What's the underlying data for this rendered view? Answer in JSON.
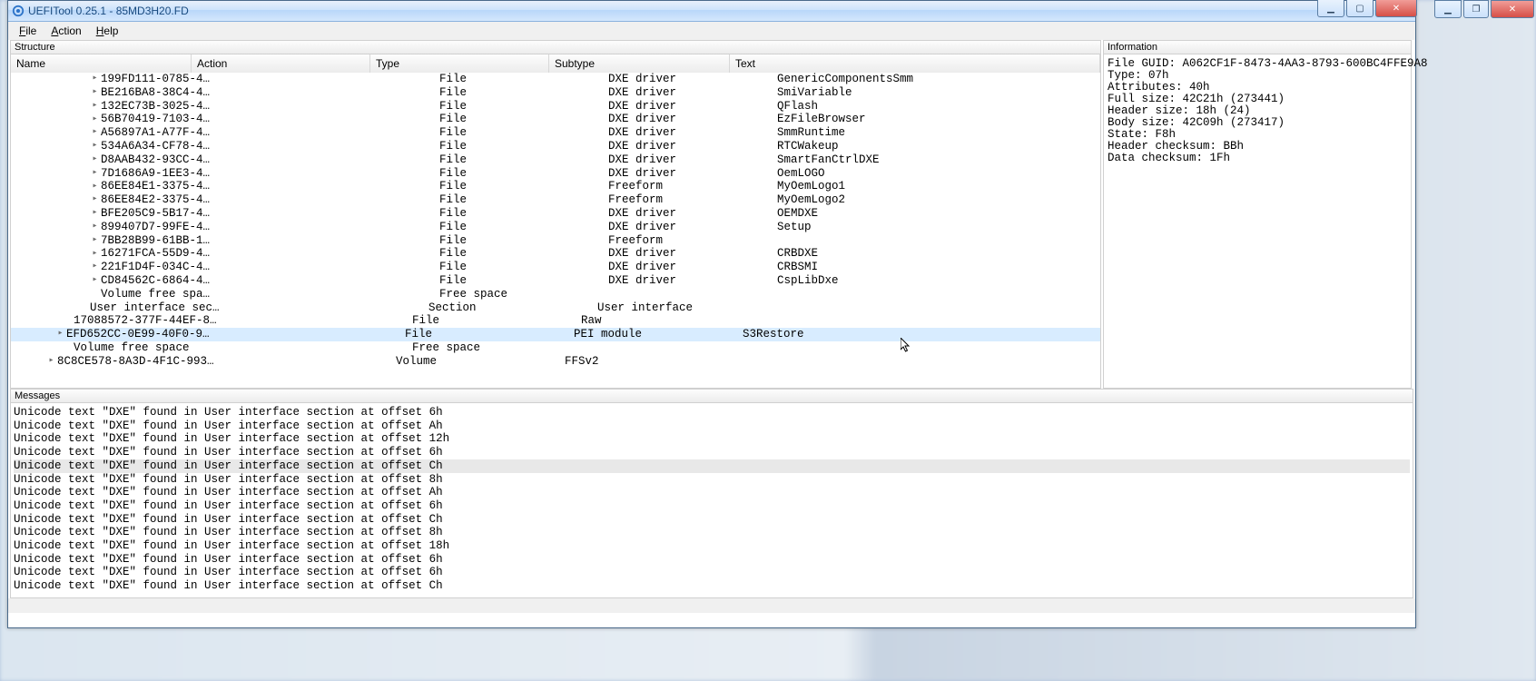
{
  "title": "UEFITool 0.25.1 - 85MD3H20.FD",
  "menus": {
    "file": "File",
    "action": "Action",
    "help": "Help"
  },
  "panels": {
    "structure": "Structure",
    "information": "Information",
    "messages": "Messages"
  },
  "columns": {
    "name": "Name",
    "action": "Action",
    "type": "Type",
    "subtype": "Subtype",
    "text": "Text"
  },
  "tree": [
    {
      "ind": 88,
      "exp": "▸",
      "name": "199FD111-0785-4…",
      "type": "File",
      "sub": "DXE driver",
      "text": "GenericComponentsSmm"
    },
    {
      "ind": 88,
      "exp": "▸",
      "name": "BE216BA8-38C4-4…",
      "type": "File",
      "sub": "DXE driver",
      "text": "SmiVariable"
    },
    {
      "ind": 88,
      "exp": "▸",
      "name": "132EC73B-3025-4…",
      "type": "File",
      "sub": "DXE driver",
      "text": "QFlash"
    },
    {
      "ind": 88,
      "exp": "▸",
      "name": "56B70419-7103-4…",
      "type": "File",
      "sub": "DXE driver",
      "text": "EzFileBrowser"
    },
    {
      "ind": 88,
      "exp": "▸",
      "name": "A56897A1-A77F-4…",
      "type": "File",
      "sub": "DXE driver",
      "text": "SmmRuntime"
    },
    {
      "ind": 88,
      "exp": "▸",
      "name": "534A6A34-CF78-4…",
      "type": "File",
      "sub": "DXE driver",
      "text": "RTCWakeup"
    },
    {
      "ind": 88,
      "exp": "▸",
      "name": "D8AAB432-93CC-4…",
      "type": "File",
      "sub": "DXE driver",
      "text": "SmartFanCtrlDXE"
    },
    {
      "ind": 88,
      "exp": "▸",
      "name": "7D1686A9-1EE3-4…",
      "type": "File",
      "sub": "DXE driver",
      "text": "OemLOGO"
    },
    {
      "ind": 88,
      "exp": "▸",
      "name": "86EE84E1-3375-4…",
      "type": "File",
      "sub": "Freeform",
      "text": "MyOemLogo1"
    },
    {
      "ind": 88,
      "exp": "▸",
      "name": "86EE84E2-3375-4…",
      "type": "File",
      "sub": "Freeform",
      "text": "MyOemLogo2"
    },
    {
      "ind": 88,
      "exp": "▸",
      "name": "BFE205C9-5B17-4…",
      "type": "File",
      "sub": "DXE driver",
      "text": "OEMDXE"
    },
    {
      "ind": 88,
      "exp": "▸",
      "name": "899407D7-99FE-4…",
      "type": "File",
      "sub": "DXE driver",
      "text": "Setup"
    },
    {
      "ind": 88,
      "exp": "▸",
      "name": "7BB28B99-61BB-1…",
      "type": "File",
      "sub": "Freeform",
      "text": ""
    },
    {
      "ind": 88,
      "exp": "▸",
      "name": "16271FCA-55D9-4…",
      "type": "File",
      "sub": "DXE driver",
      "text": "CRBDXE"
    },
    {
      "ind": 88,
      "exp": "▸",
      "name": "221F1D4F-034C-4…",
      "type": "File",
      "sub": "DXE driver",
      "text": "CRBSMI"
    },
    {
      "ind": 88,
      "exp": "▸",
      "name": "CD84562C-6864-4…",
      "type": "File",
      "sub": "DXE driver",
      "text": "CspLibDxe"
    },
    {
      "ind": 88,
      "exp": "",
      "name": "Volume free spa…",
      "type": "Free space",
      "sub": "",
      "text": ""
    },
    {
      "ind": 76,
      "exp": "",
      "name": "User interface sec…",
      "type": "Section",
      "sub": "User interface",
      "text": ""
    },
    {
      "ind": 58,
      "exp": "",
      "name": "17088572-377F-44EF-8…",
      "type": "File",
      "sub": "Raw",
      "text": ""
    },
    {
      "ind": 50,
      "exp": "▸",
      "name": "EFD652CC-0E99-40F0-9…",
      "type": "File",
      "sub": "PEI module",
      "text": "S3Restore",
      "sel": true
    },
    {
      "ind": 58,
      "exp": "",
      "name": "Volume free space",
      "type": "Free space",
      "sub": "",
      "text": ""
    },
    {
      "ind": 40,
      "exp": "▸",
      "name": "8C8CE578-8A3D-4F1C-993…",
      "type": "Volume",
      "sub": "FFSv2",
      "text": ""
    }
  ],
  "info": [
    "File GUID: A062CF1F-8473-4AA3-8793-600BC4FFE9A8",
    "Type: 07h",
    "Attributes: 40h",
    "Full size: 42C21h (273441)",
    "Header size: 18h (24)",
    "Body size: 42C09h (273417)",
    "State: F8h",
    "Header checksum: BBh",
    "Data checksum: 1Fh"
  ],
  "messages": [
    {
      "t": "Unicode text \"DXE\" found in User interface section at offset 6h"
    },
    {
      "t": "Unicode text \"DXE\" found in User interface section at offset Ah"
    },
    {
      "t": "Unicode text \"DXE\" found in User interface section at offset 12h"
    },
    {
      "t": "Unicode text \"DXE\" found in User interface section at offset 6h"
    },
    {
      "t": "Unicode text \"DXE\" found in User interface section at offset Ch",
      "sel": true
    },
    {
      "t": "Unicode text \"DXE\" found in User interface section at offset 8h"
    },
    {
      "t": "Unicode text \"DXE\" found in User interface section at offset Ah"
    },
    {
      "t": "Unicode text \"DXE\" found in User interface section at offset 6h"
    },
    {
      "t": "Unicode text \"DXE\" found in User interface section at offset Ch"
    },
    {
      "t": "Unicode text \"DXE\" found in User interface section at offset 8h"
    },
    {
      "t": "Unicode text \"DXE\" found in User interface section at offset 18h"
    },
    {
      "t": "Unicode text \"DXE\" found in User interface section at offset 6h"
    },
    {
      "t": "Unicode text \"DXE\" found in User interface section at offset 6h"
    },
    {
      "t": "Unicode text \"DXE\" found in User interface section at offset Ch"
    }
  ]
}
